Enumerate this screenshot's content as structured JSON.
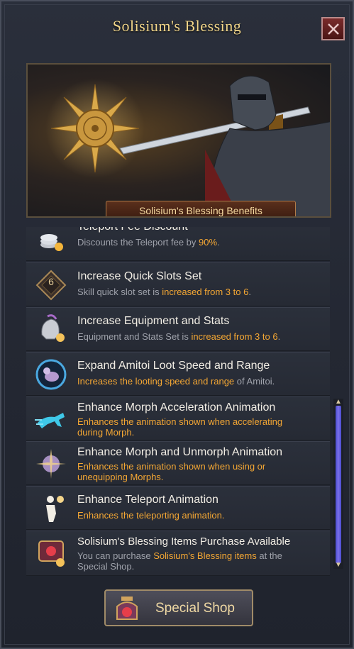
{
  "window": {
    "title": "Solisium's Blessing",
    "close_label": "X"
  },
  "banner": {
    "label": "Solisium's Blessing Benefits"
  },
  "benefits": [
    {
      "title": "Teleport Fee Discount",
      "desc_parts": [
        "Discounts the Teleport fee by ",
        "90%",
        "."
      ],
      "icon": "coins-icon"
    },
    {
      "title": "Increase Quick Slots Set",
      "desc_parts": [
        "Skill quick slot set is ",
        "increased from 3 to 6",
        "."
      ],
      "icon": "quickslot-6-icon"
    },
    {
      "title": "Increase Equipment and Stats",
      "desc_parts": [
        "Equipment and Stats Set is ",
        "increased from 3 to 6",
        "."
      ],
      "icon": "helmet-icon"
    },
    {
      "title": "Expand Amitoi Loot Speed and Range",
      "desc_parts": [
        "Increases the looting speed and range",
        " of Amitoi."
      ],
      "icon": "amitoi-icon"
    },
    {
      "title": "Enhance Morph Acceleration Animation",
      "desc_lines": [
        "Enhances the animation shown when accelerating",
        "during Morph."
      ],
      "icon": "running-beast-icon"
    },
    {
      "title": "Enhance Morph and Unmorph Animation",
      "desc_lines": [
        "Enhances the animation shown when using or",
        "unequipping Morphs."
      ],
      "icon": "morph-icon"
    },
    {
      "title": "Enhance Teleport Animation",
      "desc_lines": [
        "Enhances the teleporting animation."
      ],
      "icon": "teleport-icon"
    },
    {
      "title": "Solisium's Blessing Items Purchase Available",
      "desc_parts": [
        "You can purchase ",
        "Solisium's Blessing items",
        " at the"
      ],
      "desc_line2": "Special Shop.",
      "icon": "shop-sign-icon"
    }
  ],
  "scroll": {
    "up": "▲",
    "down": "▼"
  },
  "footer": {
    "special_shop_label": "Special Shop"
  },
  "colors": {
    "accent": "#f4a734",
    "title": "#f2d68a"
  }
}
